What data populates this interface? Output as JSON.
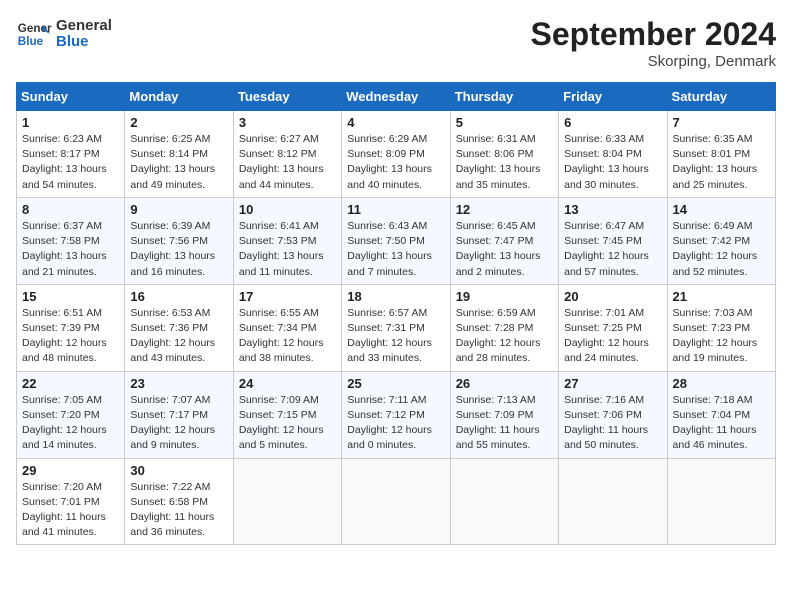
{
  "header": {
    "logo_text_general": "General",
    "logo_text_blue": "Blue",
    "month_title": "September 2024",
    "location": "Skorping, Denmark"
  },
  "weekdays": [
    "Sunday",
    "Monday",
    "Tuesday",
    "Wednesday",
    "Thursday",
    "Friday",
    "Saturday"
  ],
  "weeks": [
    [
      {
        "day": "1",
        "sunrise": "Sunrise: 6:23 AM",
        "sunset": "Sunset: 8:17 PM",
        "daylight": "Daylight: 13 hours and 54 minutes."
      },
      {
        "day": "2",
        "sunrise": "Sunrise: 6:25 AM",
        "sunset": "Sunset: 8:14 PM",
        "daylight": "Daylight: 13 hours and 49 minutes."
      },
      {
        "day": "3",
        "sunrise": "Sunrise: 6:27 AM",
        "sunset": "Sunset: 8:12 PM",
        "daylight": "Daylight: 13 hours and 44 minutes."
      },
      {
        "day": "4",
        "sunrise": "Sunrise: 6:29 AM",
        "sunset": "Sunset: 8:09 PM",
        "daylight": "Daylight: 13 hours and 40 minutes."
      },
      {
        "day": "5",
        "sunrise": "Sunrise: 6:31 AM",
        "sunset": "Sunset: 8:06 PM",
        "daylight": "Daylight: 13 hours and 35 minutes."
      },
      {
        "day": "6",
        "sunrise": "Sunrise: 6:33 AM",
        "sunset": "Sunset: 8:04 PM",
        "daylight": "Daylight: 13 hours and 30 minutes."
      },
      {
        "day": "7",
        "sunrise": "Sunrise: 6:35 AM",
        "sunset": "Sunset: 8:01 PM",
        "daylight": "Daylight: 13 hours and 25 minutes."
      }
    ],
    [
      {
        "day": "8",
        "sunrise": "Sunrise: 6:37 AM",
        "sunset": "Sunset: 7:58 PM",
        "daylight": "Daylight: 13 hours and 21 minutes."
      },
      {
        "day": "9",
        "sunrise": "Sunrise: 6:39 AM",
        "sunset": "Sunset: 7:56 PM",
        "daylight": "Daylight: 13 hours and 16 minutes."
      },
      {
        "day": "10",
        "sunrise": "Sunrise: 6:41 AM",
        "sunset": "Sunset: 7:53 PM",
        "daylight": "Daylight: 13 hours and 11 minutes."
      },
      {
        "day": "11",
        "sunrise": "Sunrise: 6:43 AM",
        "sunset": "Sunset: 7:50 PM",
        "daylight": "Daylight: 13 hours and 7 minutes."
      },
      {
        "day": "12",
        "sunrise": "Sunrise: 6:45 AM",
        "sunset": "Sunset: 7:47 PM",
        "daylight": "Daylight: 13 hours and 2 minutes."
      },
      {
        "day": "13",
        "sunrise": "Sunrise: 6:47 AM",
        "sunset": "Sunset: 7:45 PM",
        "daylight": "Daylight: 12 hours and 57 minutes."
      },
      {
        "day": "14",
        "sunrise": "Sunrise: 6:49 AM",
        "sunset": "Sunset: 7:42 PM",
        "daylight": "Daylight: 12 hours and 52 minutes."
      }
    ],
    [
      {
        "day": "15",
        "sunrise": "Sunrise: 6:51 AM",
        "sunset": "Sunset: 7:39 PM",
        "daylight": "Daylight: 12 hours and 48 minutes."
      },
      {
        "day": "16",
        "sunrise": "Sunrise: 6:53 AM",
        "sunset": "Sunset: 7:36 PM",
        "daylight": "Daylight: 12 hours and 43 minutes."
      },
      {
        "day": "17",
        "sunrise": "Sunrise: 6:55 AM",
        "sunset": "Sunset: 7:34 PM",
        "daylight": "Daylight: 12 hours and 38 minutes."
      },
      {
        "day": "18",
        "sunrise": "Sunrise: 6:57 AM",
        "sunset": "Sunset: 7:31 PM",
        "daylight": "Daylight: 12 hours and 33 minutes."
      },
      {
        "day": "19",
        "sunrise": "Sunrise: 6:59 AM",
        "sunset": "Sunset: 7:28 PM",
        "daylight": "Daylight: 12 hours and 28 minutes."
      },
      {
        "day": "20",
        "sunrise": "Sunrise: 7:01 AM",
        "sunset": "Sunset: 7:25 PM",
        "daylight": "Daylight: 12 hours and 24 minutes."
      },
      {
        "day": "21",
        "sunrise": "Sunrise: 7:03 AM",
        "sunset": "Sunset: 7:23 PM",
        "daylight": "Daylight: 12 hours and 19 minutes."
      }
    ],
    [
      {
        "day": "22",
        "sunrise": "Sunrise: 7:05 AM",
        "sunset": "Sunset: 7:20 PM",
        "daylight": "Daylight: 12 hours and 14 minutes."
      },
      {
        "day": "23",
        "sunrise": "Sunrise: 7:07 AM",
        "sunset": "Sunset: 7:17 PM",
        "daylight": "Daylight: 12 hours and 9 minutes."
      },
      {
        "day": "24",
        "sunrise": "Sunrise: 7:09 AM",
        "sunset": "Sunset: 7:15 PM",
        "daylight": "Daylight: 12 hours and 5 minutes."
      },
      {
        "day": "25",
        "sunrise": "Sunrise: 7:11 AM",
        "sunset": "Sunset: 7:12 PM",
        "daylight": "Daylight: 12 hours and 0 minutes."
      },
      {
        "day": "26",
        "sunrise": "Sunrise: 7:13 AM",
        "sunset": "Sunset: 7:09 PM",
        "daylight": "Daylight: 11 hours and 55 minutes."
      },
      {
        "day": "27",
        "sunrise": "Sunrise: 7:16 AM",
        "sunset": "Sunset: 7:06 PM",
        "daylight": "Daylight: 11 hours and 50 minutes."
      },
      {
        "day": "28",
        "sunrise": "Sunrise: 7:18 AM",
        "sunset": "Sunset: 7:04 PM",
        "daylight": "Daylight: 11 hours and 46 minutes."
      }
    ],
    [
      {
        "day": "29",
        "sunrise": "Sunrise: 7:20 AM",
        "sunset": "Sunset: 7:01 PM",
        "daylight": "Daylight: 11 hours and 41 minutes."
      },
      {
        "day": "30",
        "sunrise": "Sunrise: 7:22 AM",
        "sunset": "Sunset: 6:58 PM",
        "daylight": "Daylight: 11 hours and 36 minutes."
      },
      null,
      null,
      null,
      null,
      null
    ]
  ]
}
